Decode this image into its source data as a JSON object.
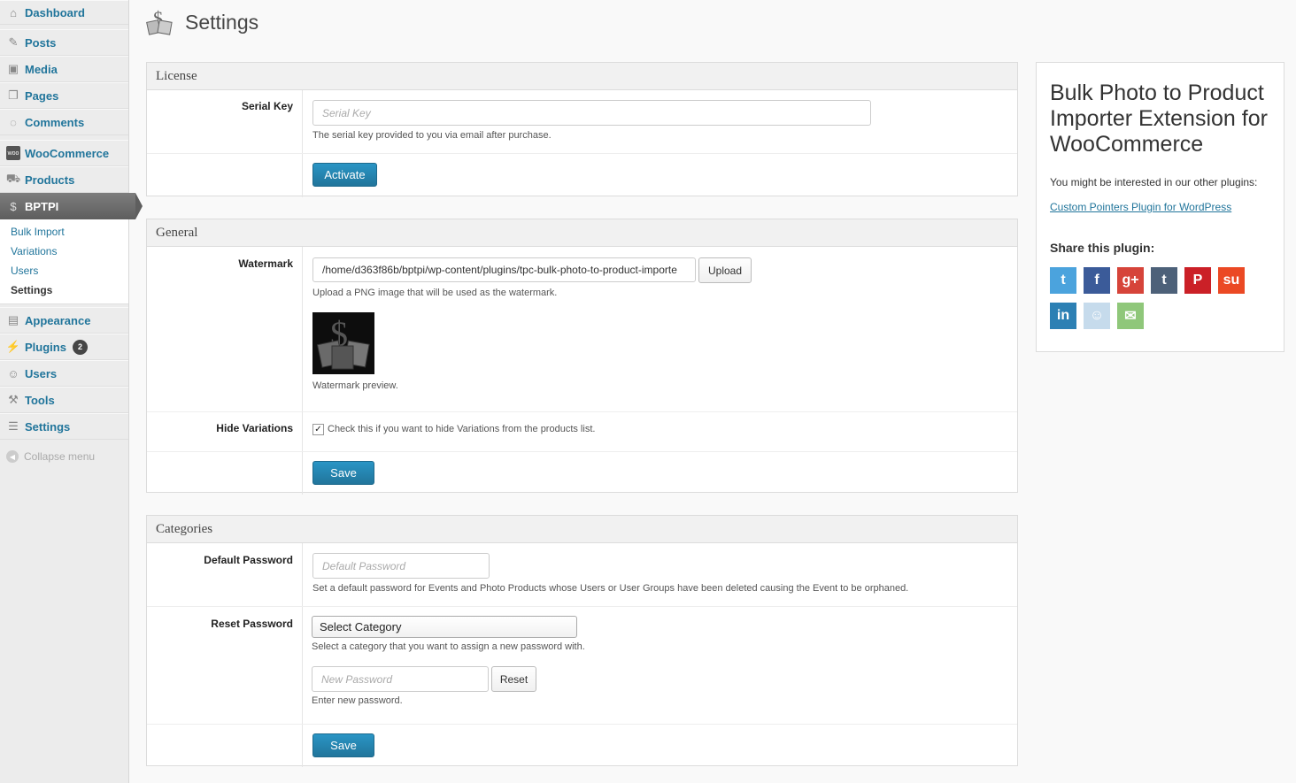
{
  "sidebar": {
    "dashboard": "Dashboard",
    "posts": "Posts",
    "media": "Media",
    "pages": "Pages",
    "comments": "Comments",
    "woocommerce": "WooCommerce",
    "woo_icon_text": "woo",
    "products": "Products",
    "bptpi": "BPTPI",
    "submenu": [
      "Bulk Import",
      "Variations",
      "Users",
      "Settings"
    ],
    "appearance": "Appearance",
    "plugins": "Plugins",
    "plugins_badge": "2",
    "users": "Users",
    "tools": "Tools",
    "settings": "Settings",
    "collapse": "Collapse menu"
  },
  "header": {
    "title": "Settings"
  },
  "license": {
    "heading": "License",
    "serial_label": "Serial Key",
    "serial_placeholder": "Serial Key",
    "serial_desc": "The serial key provided to you via email after purchase.",
    "activate": "Activate"
  },
  "general": {
    "heading": "General",
    "watermark_label": "Watermark",
    "watermark_value": "/home/d363f86b/bptpi/wp-content/plugins/tpc-bulk-photo-to-product-importe",
    "upload": "Upload",
    "watermark_desc": "Upload a PNG image that will be used as the watermark.",
    "preview_caption": "Watermark preview.",
    "hide_label": "Hide Variations",
    "hide_checked": true,
    "hide_desc": "Check this if you want to hide Variations from the products list.",
    "save": "Save"
  },
  "categories": {
    "heading": "Categories",
    "default_label": "Default Password",
    "default_placeholder": "Default Password",
    "default_desc": "Set a default password for Events and Photo Products whose Users or User Groups have been deleted causing the Event to be orphaned.",
    "reset_label": "Reset Password",
    "select_value": "Select Category",
    "select_desc": "Select a category that you want to assign a new password with.",
    "new_placeholder": "New Password",
    "reset_button": "Reset",
    "new_desc": "Enter new password.",
    "save": "Save"
  },
  "side": {
    "title": "Bulk Photo to Product Importer Extension for WooCommerce",
    "intro": "You might be interested in our other plugins:",
    "link": "Custom Pointers Plugin for WordPress",
    "share_title": "Share this plugin:",
    "share_icons": [
      {
        "name": "twitter-icon",
        "glyph": "t",
        "color": "#4ba3dd"
      },
      {
        "name": "facebook-icon",
        "glyph": "f",
        "color": "#3b5b99"
      },
      {
        "name": "google-plus-icon",
        "glyph": "g+",
        "color": "#d6443a"
      },
      {
        "name": "tumblr-icon",
        "glyph": "t",
        "color": "#4d6179"
      },
      {
        "name": "pinterest-icon",
        "glyph": "P",
        "color": "#cb2027"
      },
      {
        "name": "stumbleupon-icon",
        "glyph": "su",
        "color": "#eb4924"
      },
      {
        "name": "linkedin-icon",
        "glyph": "in",
        "color": "#2c80b4"
      },
      {
        "name": "reddit-icon",
        "glyph": "☺",
        "color": "#c6dbec"
      },
      {
        "name": "email-icon",
        "glyph": "✉",
        "color": "#8fc77a"
      }
    ]
  }
}
